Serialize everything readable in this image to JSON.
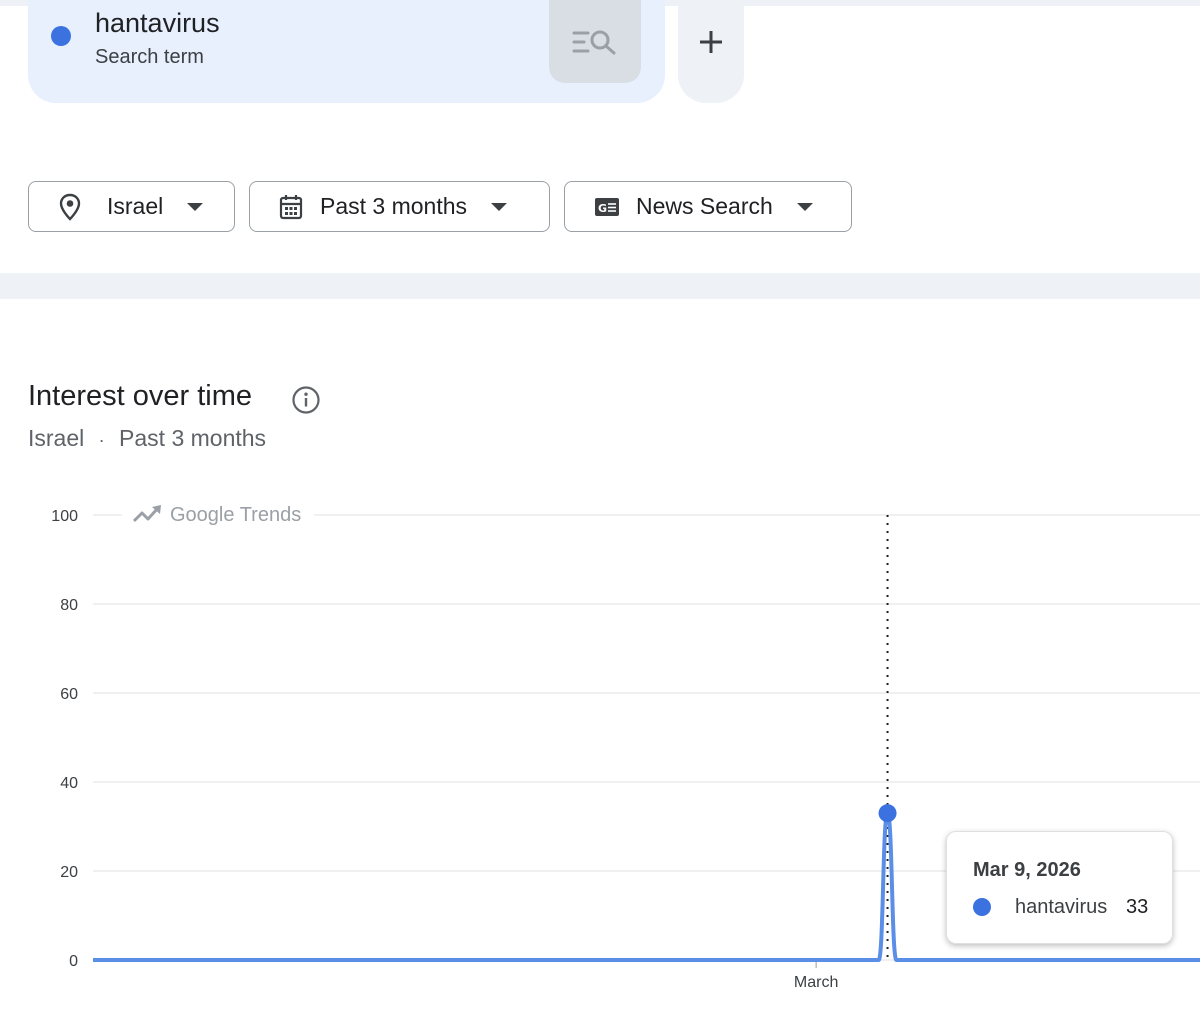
{
  "search": {
    "term": "hantavirus",
    "term_type": "Search term",
    "term_color": "#3b72e0"
  },
  "filters": {
    "location": "Israel",
    "time_range": "Past 3 months",
    "property": "News Search"
  },
  "section": {
    "title": "Interest over time",
    "location": "Israel",
    "separator": "·",
    "time_range": "Past 3 months",
    "watermark": "Google Trends"
  },
  "tooltip": {
    "date": "Mar 9, 2026",
    "term": "hantavirus",
    "value": "33"
  },
  "chart_data": {
    "type": "line",
    "ylim": [
      0,
      100
    ],
    "yticks": [
      "0",
      "20",
      "40",
      "60",
      "80",
      "100"
    ],
    "x_tick_labels": [
      "March"
    ],
    "grid": true,
    "series": [
      {
        "name": "hantavirus",
        "color": "#5b8ee6",
        "x": [
          "Mar 8, 2026",
          "Mar 9, 2026",
          "Mar 10, 2026"
        ],
        "values": [
          0,
          33,
          0
        ]
      }
    ]
  }
}
